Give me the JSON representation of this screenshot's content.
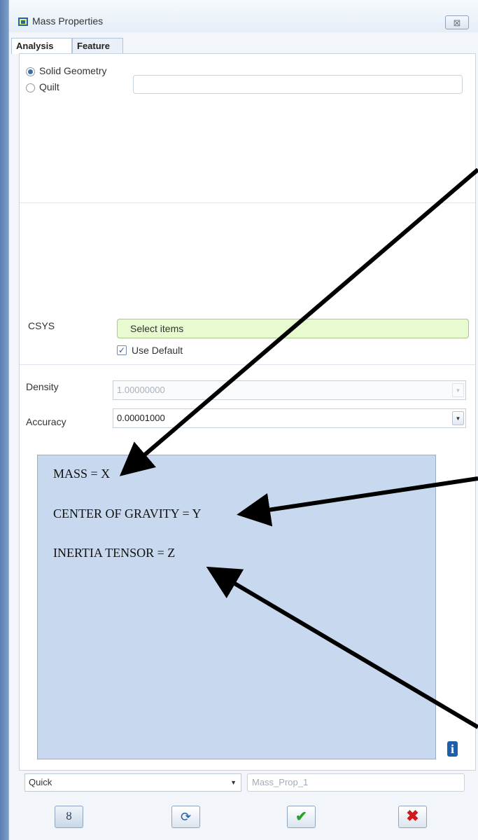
{
  "window": {
    "title": "Mass Properties",
    "close_label": "⊠"
  },
  "tabs": [
    {
      "label": "Analysis",
      "active": true
    },
    {
      "label": "Feature",
      "active": false
    }
  ],
  "geometry_type": {
    "options": [
      {
        "label": "Solid Geometry",
        "selected": true
      },
      {
        "label": "Quilt",
        "selected": false
      }
    ]
  },
  "csys": {
    "label": "CSYS",
    "collector_text": "Select items",
    "use_default_label": "Use Default",
    "use_default_checked": true
  },
  "density": {
    "label": "Density",
    "value": "1.00000000",
    "enabled": false
  },
  "accuracy": {
    "label": "Accuracy",
    "value": "0.00001000"
  },
  "results": {
    "lines": [
      "MASS = X",
      "CENTER OF GRAVITY = Y",
      "INERTIA TENSOR = Z"
    ]
  },
  "bottom": {
    "mode_value": "Quick",
    "name_placeholder": "Mass_Prop_1"
  },
  "buttons": [
    {
      "name": "preview",
      "glyph": "ȣ"
    },
    {
      "name": "repaint",
      "glyph": "⟳"
    },
    {
      "name": "ok",
      "glyph": "✔"
    },
    {
      "name": "cancel",
      "glyph": "✖"
    }
  ],
  "colors": {
    "collector_bg": "#e8fad0",
    "results_bg": "#c8d8ee",
    "info_blue": "#1f5fa9",
    "ok_green": "#2aa12a",
    "cancel_red": "#d21a1a"
  },
  "icons": [
    "app-icon",
    "close-icon",
    "info-icon",
    "preview-icon",
    "repaint-icon",
    "ok-icon",
    "cancel-icon",
    "dropdown-arrow-icon"
  ]
}
